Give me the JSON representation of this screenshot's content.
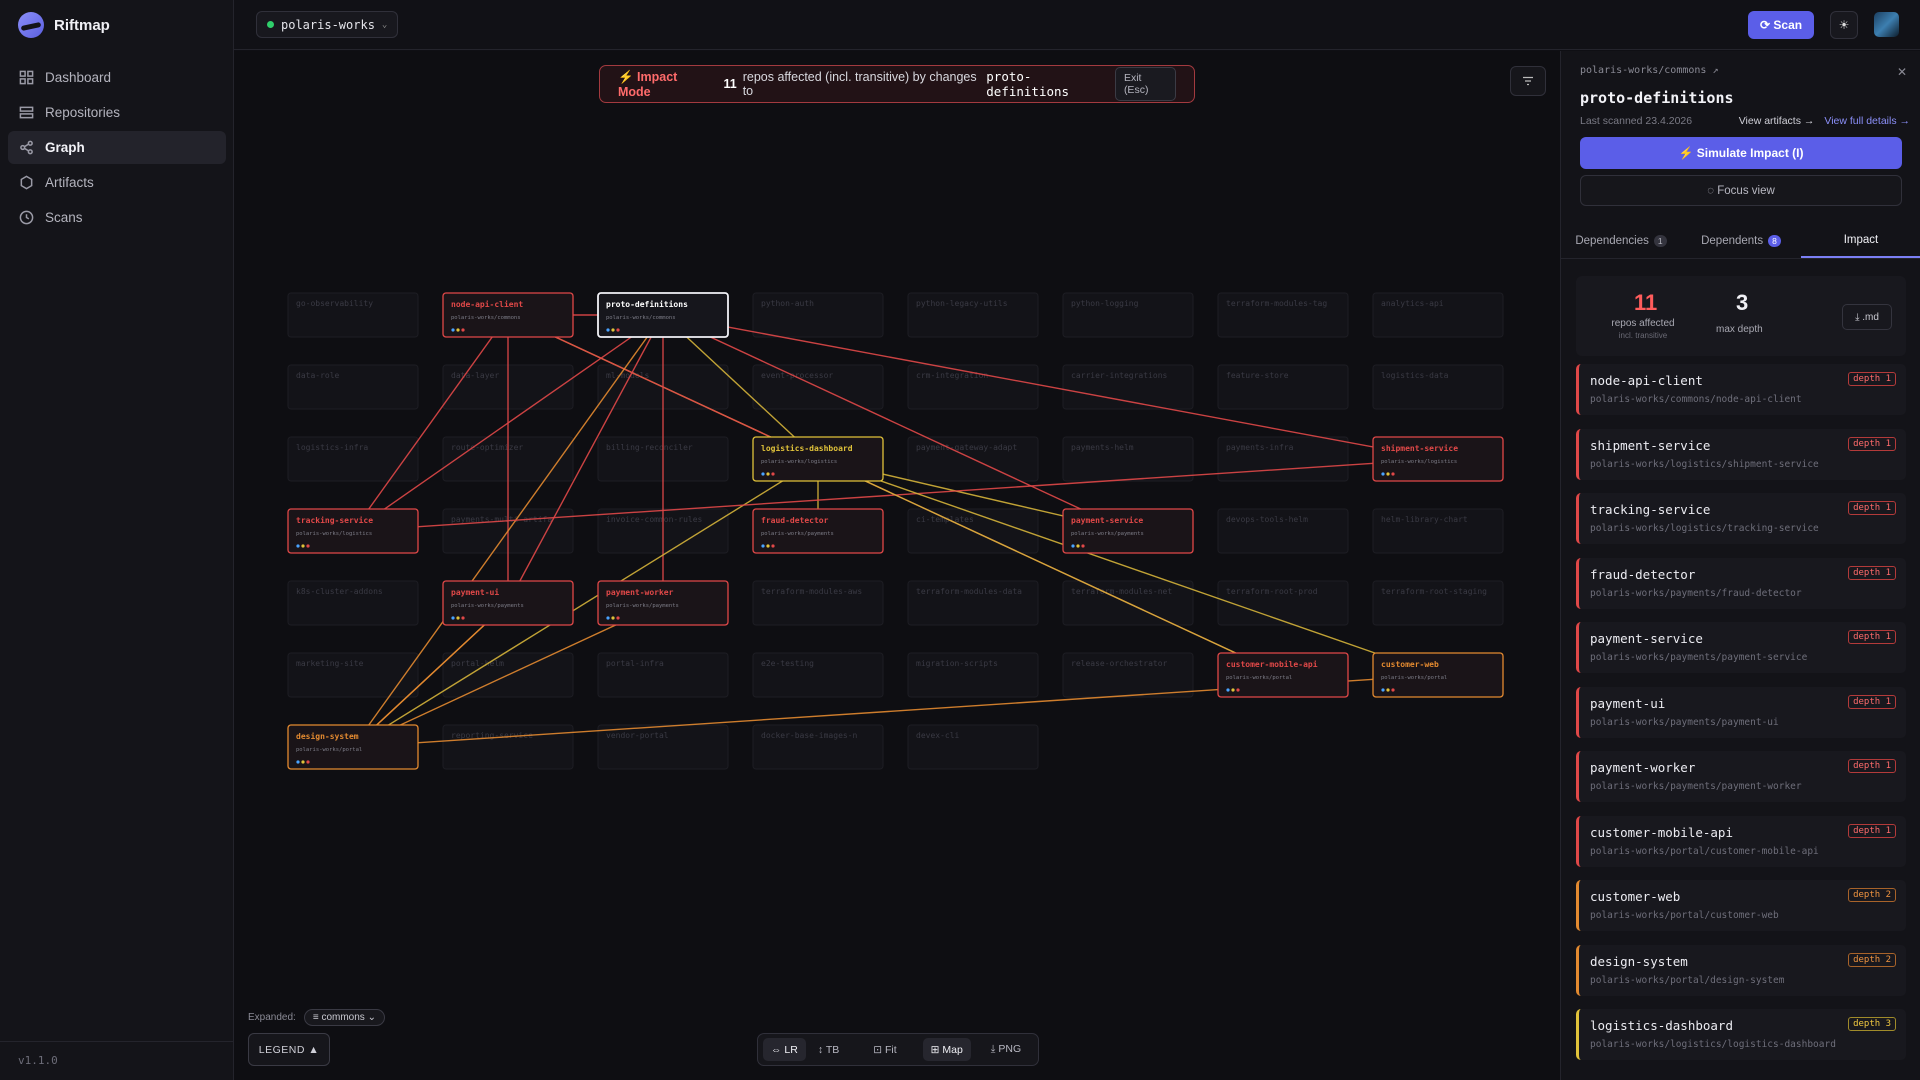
{
  "app": {
    "name": "Riftmap",
    "version": "v1.1.0"
  },
  "sidebar": {
    "items": [
      {
        "label": "Dashboard",
        "icon": "grid-icon",
        "active": false
      },
      {
        "label": "Repositories",
        "icon": "stack-icon",
        "active": false
      },
      {
        "label": "Graph",
        "icon": "share-icon",
        "active": true
      },
      {
        "label": "Artifacts",
        "icon": "hexagon-icon",
        "active": false
      },
      {
        "label": "Scans",
        "icon": "clock-icon",
        "active": false
      }
    ]
  },
  "topbar": {
    "workspace": "polaris-works",
    "scan_label": "⟳ Scan",
    "theme_icon": "sun-icon"
  },
  "banner": {
    "mode": "⚡ Impact Mode",
    "count": "11",
    "text": "repos affected (incl. transitive) by changes to",
    "target": "proto-definitions",
    "exit": "Exit (Esc)"
  },
  "graph": {
    "ghost_nodes": [
      "go-observability",
      "python-auth",
      "python-legacy-utils",
      "python-logging",
      "terraform-modules-tag",
      "analytics-api",
      "data-role",
      "data-layer",
      "ml-models",
      "event-processor",
      "crm-integration",
      "carrier-integrations",
      "feature-store",
      "logistics-data",
      "logistics-infra",
      "route-optimizer",
      "billing-reconciler",
      "payment-gateway-adapt",
      "payments-helm",
      "payments-infra",
      "payments-multi-artifa",
      "invoice-common-rules",
      "ci-templates",
      "devops-tools-helm",
      "helm-library-chart",
      "k8s-cluster-addons",
      "terraform-modules-aws",
      "terraform-modules-data",
      "terraform-modules-net",
      "terraform-root-prod",
      "terraform-root-staging",
      "marketing-site",
      "portal-helm",
      "portal-infra",
      "e2e-testing",
      "migration-scripts",
      "release-orchestrator",
      "reporting-service",
      "vendor-portal",
      "docker-base-images-n",
      "devex-cli"
    ],
    "nodes": [
      {
        "id": "node-api-client",
        "name": "node-api-client",
        "repo": "polaris-works/commons",
        "level": 1
      },
      {
        "id": "proto-definitions",
        "name": "proto-definitions",
        "repo": "polaris-works/commons",
        "level": 0
      },
      {
        "id": "logistics-dashboard",
        "name": "logistics-dashboard",
        "repo": "polaris-works/logistics",
        "level": 3
      },
      {
        "id": "shipment-service",
        "name": "shipment-service",
        "repo": "polaris-works/logistics",
        "level": 1
      },
      {
        "id": "tracking-service",
        "name": "tracking-service",
        "repo": "polaris-works/logistics",
        "level": 1
      },
      {
        "id": "fraud-detector",
        "name": "fraud-detector",
        "repo": "polaris-works/payments",
        "level": 1
      },
      {
        "id": "payment-service",
        "name": "payment-service",
        "repo": "polaris-works/payments",
        "level": 1
      },
      {
        "id": "payment-ui",
        "name": "payment-ui",
        "repo": "polaris-works/payments",
        "level": 1
      },
      {
        "id": "payment-worker",
        "name": "payment-worker",
        "repo": "polaris-works/payments",
        "level": 1
      },
      {
        "id": "customer-mobile-api",
        "name": "customer-mobile-api",
        "repo": "polaris-works/portal",
        "level": 1
      },
      {
        "id": "customer-web",
        "name": "customer-web",
        "repo": "polaris-works/portal",
        "level": 2
      },
      {
        "id": "design-system",
        "name": "design-system",
        "repo": "polaris-works/portal",
        "level": 2
      }
    ],
    "edges": [
      [
        "node-api-client",
        "proto-definitions"
      ],
      [
        "node-api-client",
        "tracking-service"
      ],
      [
        "node-api-client",
        "payment-ui"
      ],
      [
        "node-api-client",
        "logistics-dashboard"
      ],
      [
        "node-api-client",
        "customer-mobile-api"
      ],
      [
        "proto-definitions",
        "payment-ui"
      ],
      [
        "proto-definitions",
        "payment-worker"
      ],
      [
        "proto-definitions",
        "logistics-dashboard"
      ],
      [
        "proto-definitions",
        "shipment-service"
      ],
      [
        "proto-definitions",
        "payment-service"
      ],
      [
        "proto-definitions",
        "tracking-service"
      ],
      [
        "proto-definitions",
        "design-system"
      ],
      [
        "logistics-dashboard",
        "fraud-detector"
      ],
      [
        "logistics-dashboard",
        "payment-service"
      ],
      [
        "logistics-dashboard",
        "design-system"
      ],
      [
        "tracking-service",
        "shipment-service"
      ],
      [
        "payment-ui",
        "design-system"
      ],
      [
        "payment-worker",
        "design-system"
      ],
      [
        "customer-web",
        "design-system"
      ],
      [
        "customer-mobile-api",
        "logistics-dashboard"
      ],
      [
        "customer-web",
        "logistics-dashboard"
      ],
      [
        "design-system",
        "payment-ui"
      ]
    ]
  },
  "canvas": {
    "expanded_label": "Expanded:",
    "expanded_chip": "≡ commons ⌄",
    "legend": "LEGEND ▲",
    "toolbar": [
      {
        "label": "⇔ LR",
        "active": true
      },
      {
        "label": "↕ TB",
        "active": false
      },
      {
        "label": "⊡ Fit",
        "active": false
      },
      {
        "label": "⊞ Map",
        "active": true
      },
      {
        "label": "⤓ PNG",
        "active": false
      }
    ]
  },
  "panel": {
    "crumb": "polaris-works/commons",
    "title": "proto-definitions",
    "last_scanned": "Last scanned 23.4.2026",
    "view_artifacts": "View artifacts →",
    "view_full": "View full details →",
    "simulate": "⚡ Simulate Impact (I)",
    "focus": "◌ Focus view",
    "tabs": [
      {
        "label": "Dependencies",
        "badge": "1"
      },
      {
        "label": "Dependents",
        "badge": "8"
      },
      {
        "label": "Impact",
        "badge": ""
      }
    ],
    "stats": {
      "affected": "11",
      "affected_label": "repos affected",
      "affected_sub": "incl. transitive",
      "depth": "3",
      "depth_label": "max depth",
      "export": "⤓ .md"
    },
    "impact_list": [
      {
        "name": "node-api-client",
        "path": "polaris-works/commons/node-api-client",
        "depth": "depth 1"
      },
      {
        "name": "shipment-service",
        "path": "polaris-works/logistics/shipment-service",
        "depth": "depth 1"
      },
      {
        "name": "tracking-service",
        "path": "polaris-works/logistics/tracking-service",
        "depth": "depth 1"
      },
      {
        "name": "fraud-detector",
        "path": "polaris-works/payments/fraud-detector",
        "depth": "depth 1"
      },
      {
        "name": "payment-service",
        "path": "polaris-works/payments/payment-service",
        "depth": "depth 1"
      },
      {
        "name": "payment-ui",
        "path": "polaris-works/payments/payment-ui",
        "depth": "depth 1"
      },
      {
        "name": "payment-worker",
        "path": "polaris-works/payments/payment-worker",
        "depth": "depth 1"
      },
      {
        "name": "customer-mobile-api",
        "path": "polaris-works/portal/customer-mobile-api",
        "depth": "depth 1"
      },
      {
        "name": "customer-web",
        "path": "polaris-works/portal/customer-web",
        "depth": "depth 2"
      },
      {
        "name": "design-system",
        "path": "polaris-works/portal/design-system",
        "depth": "depth 2"
      },
      {
        "name": "logistics-dashboard",
        "path": "polaris-works/logistics/logistics-dashboard",
        "depth": "depth 3"
      }
    ]
  }
}
